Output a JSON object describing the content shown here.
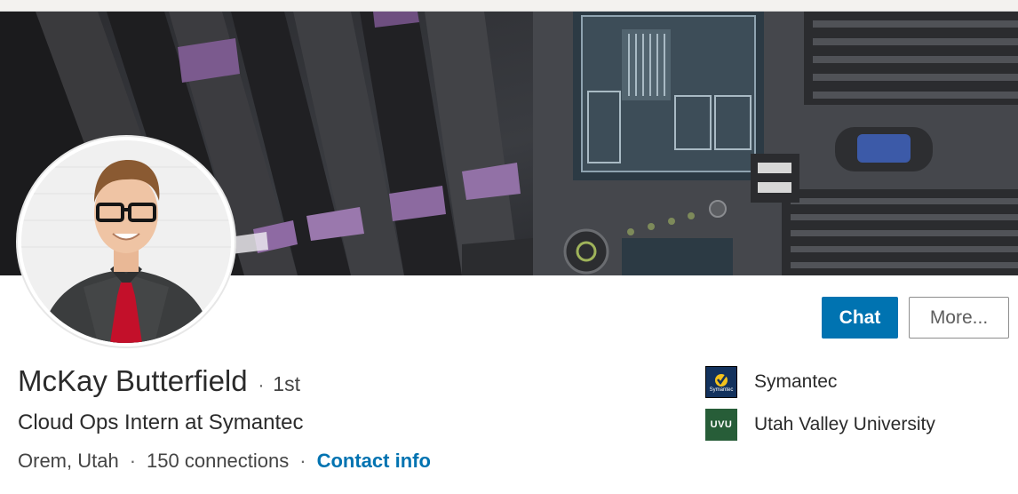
{
  "profile": {
    "name": "McKay Butterfield",
    "degree": "1st",
    "degree_separator": "·",
    "headline": "Cloud Ops Intern at Symantec",
    "location": "Orem, Utah",
    "connections": "150 connections",
    "contact_link": "Contact info",
    "meta_separator": "·"
  },
  "actions": {
    "chat_label": "Chat",
    "more_label": "More..."
  },
  "organizations": [
    {
      "name": "Symantec",
      "logo_icon": "symantec-logo-icon",
      "logo_color": "#13325d",
      "logo_text": "Symantec"
    },
    {
      "name": "Utah Valley University",
      "logo_icon": "uvu-logo-icon",
      "logo_color": "#275d38",
      "logo_text": "UVU"
    }
  ],
  "banner": {
    "icon": "server-rack-banner-image"
  },
  "colors": {
    "accent": "#0073b1",
    "text": "#2b2b2b"
  }
}
